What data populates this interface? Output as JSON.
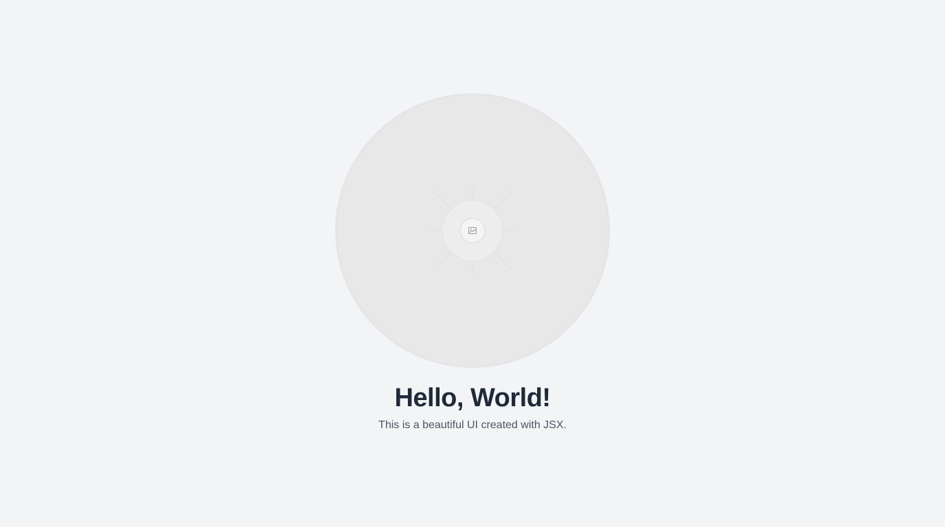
{
  "hero": {
    "image_icon": "image-placeholder-icon"
  },
  "heading": {
    "title": "Hello, World!",
    "subtitle": "This is a beautiful UI created with JSX."
  },
  "colors": {
    "background": "#f3f4f6",
    "circle_fill": "#e8e8e9",
    "title_text": "#1f2937",
    "subtitle_text": "#4b5563"
  }
}
